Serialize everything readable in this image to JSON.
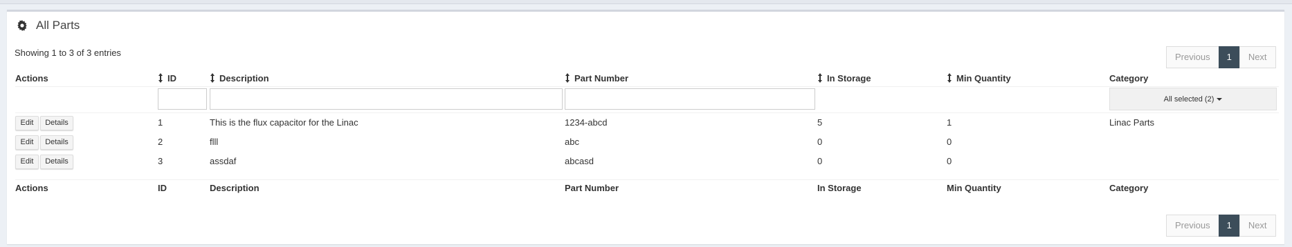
{
  "box": {
    "title": "All Parts",
    "icon": "gear-icon"
  },
  "info": "Showing 1 to 3 of 3 entries",
  "pagination": {
    "previous": "Previous",
    "current": "1",
    "next": "Next"
  },
  "columns": {
    "actions": "Actions",
    "id": "ID",
    "description": "Description",
    "part_number": "Part Number",
    "in_storage": "In Storage",
    "min_quantity": "Min Quantity",
    "category": "Category"
  },
  "filters": {
    "id": "",
    "description": "",
    "part_number": "",
    "category_select": "All selected (2)"
  },
  "buttons": {
    "edit": "Edit",
    "details": "Details"
  },
  "rows": [
    {
      "id": "1",
      "description": "This is the flux capacitor for the Linac",
      "part_number": "1234-abcd",
      "in_storage": "5",
      "min_quantity": "1",
      "category": "Linac Parts"
    },
    {
      "id": "2",
      "description": "flll",
      "part_number": "abc",
      "in_storage": "0",
      "min_quantity": "0",
      "category": ""
    },
    {
      "id": "3",
      "description": "assdaf",
      "part_number": "abcasd",
      "in_storage": "0",
      "min_quantity": "0",
      "category": ""
    }
  ],
  "colors": {
    "accent": "#3c4d5a",
    "link": "#3c8dbc"
  }
}
